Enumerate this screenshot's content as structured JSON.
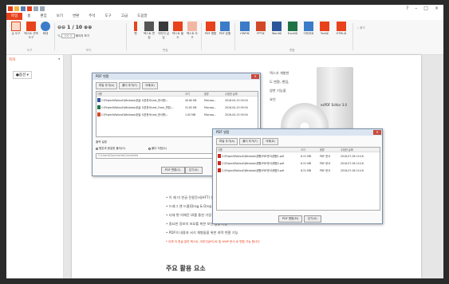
{
  "menubar": {
    "items": [
      "파일",
      "홈",
      "편집",
      "보기",
      "변환",
      "주석",
      "도구",
      "고급",
      "도움말"
    ]
  },
  "ribbon": {
    "buttons": [
      {
        "label": "손 도구",
        "icon": "hand-icon"
      },
      {
        "label": "텍스트 선택 도구",
        "icon": "text-select-icon"
      },
      {
        "label": "확대",
        "icon": "zoom-icon"
      },
      {
        "label": "펜",
        "icon": "pen-icon"
      },
      {
        "label": "텍스트 편집",
        "icon": "text-edit-icon"
      },
      {
        "label": "이미지 삽입",
        "icon": "image-icon"
      },
      {
        "label": "텍스트 필드",
        "icon": "text-field-icon"
      },
      {
        "label": "텍스트 도구",
        "icon": "text-tool-icon"
      },
      {
        "label": "PDF 병합",
        "icon": "merge-icon"
      },
      {
        "label": "PDF 분할",
        "icon": "split-icon"
      },
      {
        "label": "HWP로",
        "icon": "to-hwp-icon"
      },
      {
        "label": "PPT로",
        "icon": "to-ppt-icon"
      },
      {
        "label": "Word로",
        "icon": "to-word-icon"
      },
      {
        "label": "Excel로",
        "icon": "to-excel-icon"
      },
      {
        "label": "이미지로",
        "icon": "to-image-icon"
      },
      {
        "label": "Text로",
        "icon": "to-text-icon"
      },
      {
        "label": "HTML로",
        "icon": "to-html-icon"
      }
    ],
    "zoom_value": "100 %",
    "page_value": "1",
    "page_total": "/ 10",
    "fit_label": "페이지 보기",
    "find_label": "찾기",
    "groups": [
      "도구",
      "보기",
      "편집",
      "변환"
    ]
  },
  "sidebar": {
    "title": "목차",
    "item": "●옵션 ▾"
  },
  "document": {
    "lines_top": [
      "덱스가 개발한",
      "도 변환, 편집,",
      "양한 기능을",
      "요인"
    ],
    "lines_bottom": [
      "• 이 제 미 한글 전용문서(HFT) 변환 가능",
      "• 드래그 앤 드롭(Drag & Drop)으로 변환 가능",
      "• 다재 편 의해진 UI를 통한 가장 쉬운 PDF 변환",
      "• 중요한 정보의 보호를 위한 보안 설정 기능",
      "• PDF의 내용과 서식 체형들을 위한 최적 변환 기능"
    ],
    "note": "* 이제 더 한글 일반 텍스트, 이미지(JPG)도 및 HWP 문서 로 변환 가능 합니다",
    "heading": "주요 활용 요소",
    "product_name": "ezPDF Editor 3.0"
  },
  "dialog1": {
    "title": "PDF 변환",
    "toolbar": [
      "파일 추가(A)",
      "폴더 추가(F)",
      "삭제(D)"
    ],
    "columns": [
      "이름",
      "크기",
      "종류",
      "수정한 날짜"
    ],
    "rows": [
      {
        "name": "C:\\Project\\Rollout\\Windows\\한글 사본문서\\rest_문서폴\\...",
        "size": "40.60 KB",
        "type": "Microso...",
        "date": "2016-04-15 09:34"
      },
      {
        "name": "C:\\Project\\Rollout\\Windows\\한글 사본문서\\rest_Form_편집\\...",
        "size": "31.82 KB",
        "type": "Microso...",
        "date": "2016-04-15 09:34"
      },
      {
        "name": "C:\\Project\\Rollout\\Windows\\한글 사본문서\\rest_문서폴\\...",
        "size": "1.00 MB",
        "type": "Microso...",
        "date": "2016-04-15 09:34"
      }
    ],
    "output_label": "출력 설정",
    "radio1": "원본과 동일한 폴더(O)",
    "radio2": "폴더 지정(S)",
    "path": "C:\\Users\\Documents\\Converted",
    "ok": "PDF 변환(C)",
    "cancel": "닫기(X)"
  },
  "dialog2": {
    "title": "PDF 병합",
    "toolbar": [
      "파일 추가(A)",
      "폴더 추가(F)",
      "삭제(D)"
    ],
    "columns": [
      "이름",
      "크기",
      "종류",
      "수정한 날짜"
    ],
    "rows": [
      {
        "name": "C:\\Project\\Rollout\\Windows\\병합\\PDF문서\\병합1.pdf",
        "size": "8.31 MB",
        "type": "PDF 문서",
        "date": "2016-07-06 10:16"
      },
      {
        "name": "C:\\Project\\Rollout\\Windows\\병합\\PDF문서\\병합2.pdf",
        "size": "8.31 MB",
        "type": "PDF 문서",
        "date": "2016-07-06 10:16"
      },
      {
        "name": "C:\\Project\\Rollout\\Windows\\병합\\PDF문서\\병합3.pdf",
        "size": "8.31 MB",
        "type": "PDF 문서",
        "date": "2016-07-06 10:16"
      }
    ],
    "ok": "PDF 병합(M)",
    "cancel": "닫기(X)"
  },
  "colors": {
    "accent": "#e8421c",
    "dialog_title": "#dbe5f1"
  }
}
